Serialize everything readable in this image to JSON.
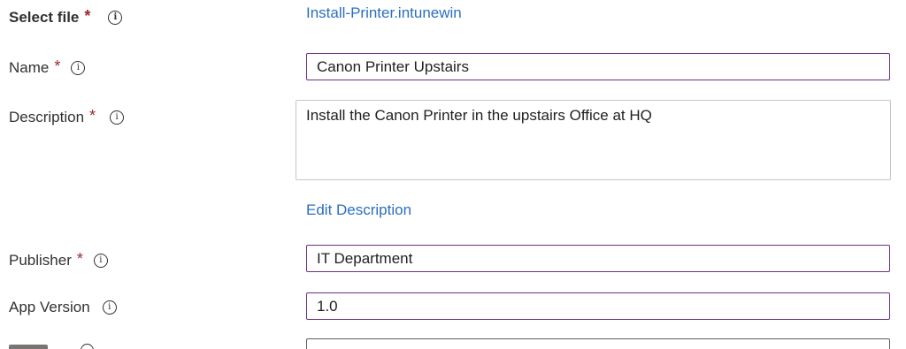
{
  "form": {
    "select_file": {
      "label": "Select file",
      "required_mark": "*",
      "info_glyph": "i",
      "link_text": "Install-Printer.intunewin"
    },
    "name": {
      "label": "Name",
      "required_mark": "*",
      "info_glyph": "i",
      "value": "Canon Printer Upstairs"
    },
    "description": {
      "label": "Description",
      "required_mark": "*",
      "info_glyph": "i",
      "value": "Install the Canon Printer in the upstairs Office at HQ",
      "edit_link": "Edit Description"
    },
    "publisher": {
      "label": "Publisher",
      "required_mark": "*",
      "info_glyph": "i",
      "value": "IT Department"
    },
    "app_version": {
      "label": "App Version",
      "info_glyph": "i",
      "value": "1.0"
    }
  },
  "colors": {
    "required": "#a4262c",
    "link": "#2b6fbf",
    "focused_border": "#6b2f85",
    "textarea_border": "#c8c6c4"
  }
}
